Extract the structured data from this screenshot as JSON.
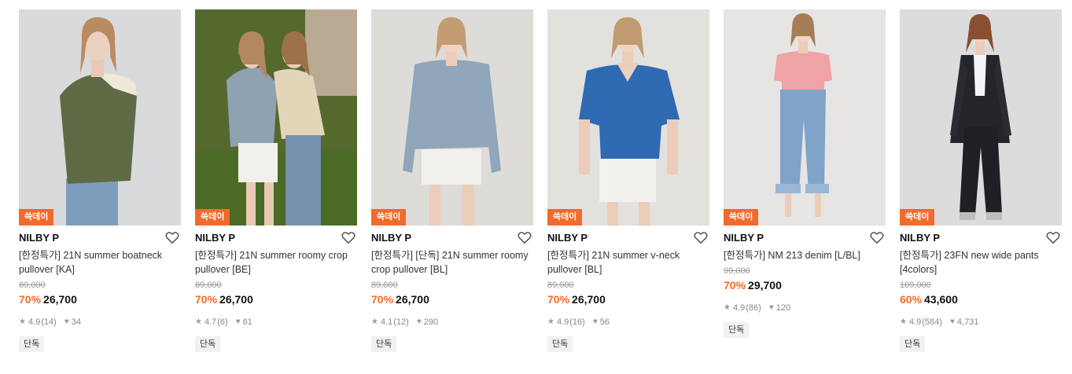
{
  "colors": {
    "accent": "#f06b2c",
    "muted": "#999999"
  },
  "products": [
    {
      "badge": "쓱데이",
      "brand": "NILBY P",
      "title": "[한정특가] 21N summer boatneck pullover [KA]",
      "original_price": "89,000",
      "discount": "70%",
      "price": "26,700",
      "rating": "4.9",
      "reviews": "(14)",
      "likes": "34",
      "tag": "단독"
    },
    {
      "badge": "쓱데이",
      "brand": "NILBY P",
      "title": "[한정특가] 21N summer roomy crop pullover [BE]",
      "original_price": "89,000",
      "discount": "70%",
      "price": "26,700",
      "rating": "4.7",
      "reviews": "(6)",
      "likes": "61",
      "tag": "단독"
    },
    {
      "badge": "쓱데이",
      "brand": "NILBY P",
      "title": "[한정특가] [단독] 21N summer roomy crop pullover [BL]",
      "original_price": "89,000",
      "discount": "70%",
      "price": "26,700",
      "rating": "4.1",
      "reviews": "(12)",
      "likes": "290",
      "tag": "단독"
    },
    {
      "badge": "쓱데이",
      "brand": "NILBY P",
      "title": "[한정특가] 21N summer v-neck pullover [BL]",
      "original_price": "89,000",
      "discount": "70%",
      "price": "26,700",
      "rating": "4.9",
      "reviews": "(16)",
      "likes": "56",
      "tag": "단독"
    },
    {
      "badge": "쓱데이",
      "brand": "NILBY P",
      "title": "[한정특가] NM 213 denim [L/BL]",
      "original_price": "99,000",
      "discount": "70%",
      "price": "29,700",
      "rating": "4.9",
      "reviews": "(86)",
      "likes": "120",
      "tag": "단독"
    },
    {
      "badge": "쓱데이",
      "brand": "NILBY P",
      "title": "[한정특가] 23FN new wide pants [4colors]",
      "original_price": "109,000",
      "discount": "60%",
      "price": "43,600",
      "rating": "4.9",
      "reviews": "(584)",
      "likes": "4,731",
      "tag": "단독"
    }
  ]
}
